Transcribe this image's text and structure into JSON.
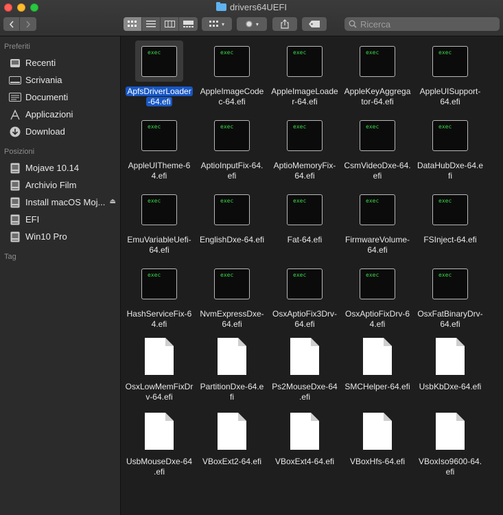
{
  "window": {
    "title": "drivers64UEFI"
  },
  "toolbar": {
    "search_placeholder": "Ricerca",
    "view_modes": [
      "icon-view",
      "list-view",
      "column-view",
      "gallery-view"
    ],
    "share_icon": "share-icon",
    "tag_icon": "tag-icon",
    "action_icon": "gear-icon",
    "group_icon": "group-grid-icon"
  },
  "sidebar": {
    "favorites_header": "Preferiti",
    "favorites": [
      {
        "label": "Recenti",
        "icon": "clock-icon"
      },
      {
        "label": "Scrivania",
        "icon": "desktop-icon"
      },
      {
        "label": "Documenti",
        "icon": "document-icon"
      },
      {
        "label": "Applicazioni",
        "icon": "applications-icon"
      },
      {
        "label": "Download",
        "icon": "download-icon"
      }
    ],
    "locations_header": "Posizioni",
    "locations": [
      {
        "label": "Mojave 10.14",
        "icon": "disk-icon"
      },
      {
        "label": "Archivio Film",
        "icon": "disk-icon"
      },
      {
        "label": "Install macOS Moj...",
        "icon": "disk-icon",
        "eject": "⏏"
      },
      {
        "label": "EFI",
        "icon": "disk-icon"
      },
      {
        "label": "Win10 Pro",
        "icon": "disk-icon"
      }
    ],
    "tags_header": "Tag"
  },
  "files": [
    {
      "name": "ApfsDriverLoader-64.efi",
      "lines": [
        "ApfsDriverLoader",
        "-64.efi"
      ],
      "type": "exec",
      "selected": true
    },
    {
      "name": "AppleImageCodec-64.efi",
      "lines": [
        "AppleImageCode",
        "c-64.efi"
      ],
      "type": "exec"
    },
    {
      "name": "AppleImageLoader-64.efi",
      "lines": [
        "AppleImageLoade",
        "r-64.efi"
      ],
      "type": "exec"
    },
    {
      "name": "AppleKeyAggregator-64.efi",
      "lines": [
        "AppleKeyAggrega",
        "tor-64.efi"
      ],
      "type": "exec"
    },
    {
      "name": "AppleUISupport-64.efi",
      "lines": [
        "AppleUISupport-",
        "64.efi"
      ],
      "type": "exec"
    },
    {
      "name": "AppleUITheme-64.efi",
      "lines": [
        "AppleUITheme-6",
        "4.efi"
      ],
      "type": "exec"
    },
    {
      "name": "AptioInputFix-64.efi",
      "lines": [
        "AptioInputFix-64.",
        "efi"
      ],
      "type": "exec"
    },
    {
      "name": "AptioMemoryFix-64.efi",
      "lines": [
        "AptioMemoryFix-",
        "64.efi"
      ],
      "type": "exec"
    },
    {
      "name": "CsmVideoDxe-64.efi",
      "lines": [
        "CsmVideoDxe-64.",
        "efi"
      ],
      "type": "exec"
    },
    {
      "name": "DataHubDxe-64.efi",
      "lines": [
        "DataHubDxe-64.e",
        "fi"
      ],
      "type": "exec"
    },
    {
      "name": "EmuVariableUefi-64.efi",
      "lines": [
        "EmuVariableUefi-",
        "64.efi"
      ],
      "type": "exec"
    },
    {
      "name": "EnglishDxe-64.efi",
      "lines": [
        "EnglishDxe-64.efi"
      ],
      "type": "exec"
    },
    {
      "name": "Fat-64.efi",
      "lines": [
        "Fat-64.efi"
      ],
      "type": "exec"
    },
    {
      "name": "FirmwareVolume-64.efi",
      "lines": [
        "FirmwareVolume-",
        "64.efi"
      ],
      "type": "exec"
    },
    {
      "name": "FSInject-64.efi",
      "lines": [
        "FSInject-64.efi"
      ],
      "type": "exec"
    },
    {
      "name": "HashServiceFix-64.efi",
      "lines": [
        "HashServiceFix-6",
        "4.efi"
      ],
      "type": "exec"
    },
    {
      "name": "NvmExpressDxe-64.efi",
      "lines": [
        "NvmExpressDxe-",
        "64.efi"
      ],
      "type": "exec"
    },
    {
      "name": "OsxAptioFix3Drv-64.efi",
      "lines": [
        "OsxAptioFix3Drv-",
        "64.efi"
      ],
      "type": "exec"
    },
    {
      "name": "OsxAptioFixDrv-64.efi",
      "lines": [
        "OsxAptioFixDrv-6",
        "4.efi"
      ],
      "type": "exec"
    },
    {
      "name": "OsxFatBinaryDrv-64.efi",
      "lines": [
        "OsxFatBinaryDrv-",
        "64.efi"
      ],
      "type": "exec"
    },
    {
      "name": "OsxLowMemFixDrv-64.efi",
      "lines": [
        "OsxLowMemFixDr",
        "v-64.efi"
      ],
      "type": "doc"
    },
    {
      "name": "PartitionDxe-64.efi",
      "lines": [
        "PartitionDxe-64.e",
        "fi"
      ],
      "type": "doc"
    },
    {
      "name": "Ps2MouseDxe-64.efi",
      "lines": [
        "Ps2MouseDxe-64",
        ".efi"
      ],
      "type": "doc"
    },
    {
      "name": "SMCHelper-64.efi",
      "lines": [
        "SMCHelper-64.efi"
      ],
      "type": "doc"
    },
    {
      "name": "UsbKbDxe-64.efi",
      "lines": [
        "UsbKbDxe-64.efi"
      ],
      "type": "doc"
    },
    {
      "name": "UsbMouseDxe-64.efi",
      "lines": [
        "UsbMouseDxe-64",
        ".efi"
      ],
      "type": "doc"
    },
    {
      "name": "VBoxExt2-64.efi",
      "lines": [
        "VBoxExt2-64.efi"
      ],
      "type": "doc"
    },
    {
      "name": "VBoxExt4-64.efi",
      "lines": [
        "VBoxExt4-64.efi"
      ],
      "type": "doc"
    },
    {
      "name": "VBoxHfs-64.efi",
      "lines": [
        "VBoxHfs-64.efi"
      ],
      "type": "doc"
    },
    {
      "name": "VBoxIso9600-64.efi",
      "lines": [
        "VBoxIso9600-64.",
        "efi"
      ],
      "type": "doc"
    }
  ],
  "exec_badge": "exec",
  "colors": {
    "selection": "#1857c4",
    "exec_text": "#3bd64a",
    "sidebar_bg": "#2b2b2c",
    "content_bg": "#1e1e1e"
  }
}
